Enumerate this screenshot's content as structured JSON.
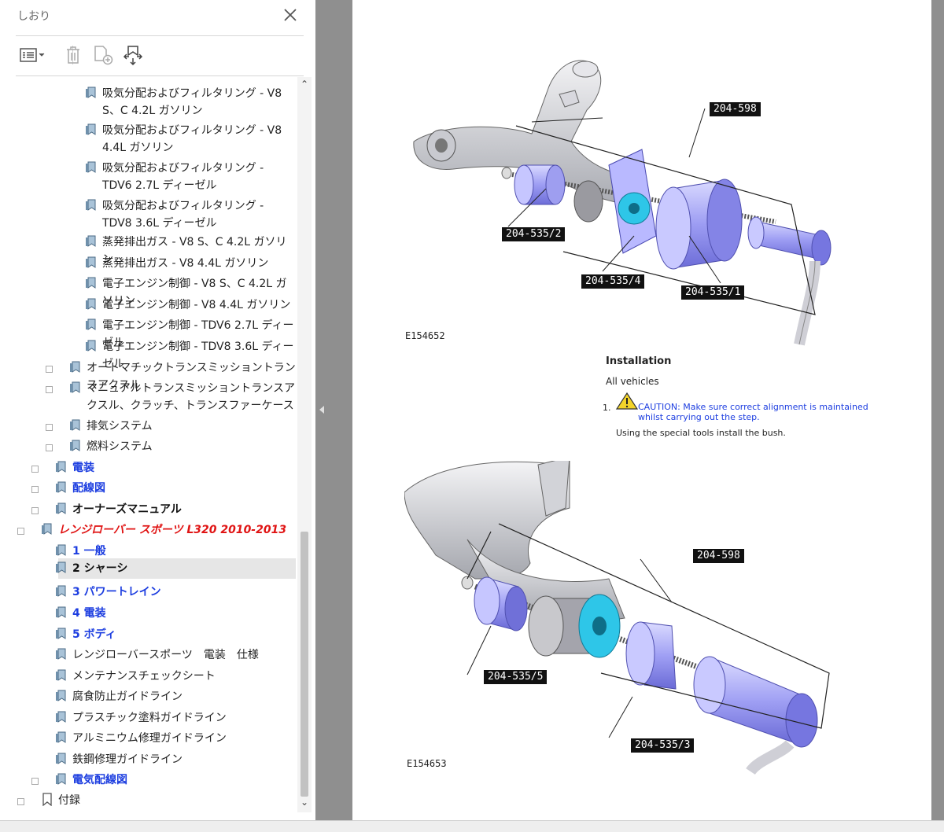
{
  "panel": {
    "title": "しおり",
    "toolbar": [
      "options-menu",
      "delete-bookmark",
      "new-bookmark",
      "expand-bookmark"
    ]
  },
  "tree": [
    {
      "label": "吸気分配およびフィルタリング - V8 S、C 4.2L ガソリン",
      "style": "norm",
      "expander": false
    },
    {
      "label": "吸気分配およびフィルタリング - V8 4.4L ガソリン",
      "style": "norm",
      "expander": false
    },
    {
      "label": "吸気分配およびフィルタリング - TDV6 2.7L ディーゼル",
      "style": "norm",
      "expander": false
    },
    {
      "label": "吸気分配およびフィルタリング - TDV8 3.6L ディーゼル",
      "style": "norm",
      "expander": false
    },
    {
      "label": "蒸発排出ガス - V8 S、C 4.2L ガソリン",
      "style": "norm",
      "expander": false
    },
    {
      "label": "蒸発排出ガス - V8 4.4L ガソリン",
      "style": "norm",
      "expander": false
    },
    {
      "label": "電子エンジン制御 - V8 S、C 4.2L ガソリン",
      "style": "norm",
      "expander": false
    },
    {
      "label": "電子エンジン制御 - V8 4.4L ガソリン",
      "style": "norm",
      "expander": false
    },
    {
      "label": "電子エンジン制御 - TDV6 2.7L ディーゼル",
      "style": "norm",
      "expander": false
    },
    {
      "label": "電子エンジン制御 - TDV8 3.6L ディーゼル",
      "style": "norm",
      "expander": false
    },
    {
      "label": "オートマチックトランスミッショントランスアクスル",
      "style": "norm",
      "expander": true
    },
    {
      "label": "マニュアルトランスミッショントランスアクスル、クラッチ、トランスファーケース",
      "style": "norm",
      "expander": true
    },
    {
      "label": "排気システム",
      "style": "norm",
      "expander": true
    },
    {
      "label": "燃料システム",
      "style": "norm",
      "expander": true
    },
    {
      "label": "電装",
      "style": "blue",
      "expander": true
    },
    {
      "label": "配線図",
      "style": "blue",
      "expander": true
    },
    {
      "label": "オーナーズマニュアル",
      "style": "black",
      "expander": true
    },
    {
      "label": "レンジローバー スポーツ L320 2010-2013",
      "style": "red",
      "expander": true
    },
    {
      "label": "1 一般",
      "style": "blue",
      "expander": false
    },
    {
      "label": "2 シャーシ",
      "style": "black",
      "expander": false,
      "selected": true
    },
    {
      "label": "3 パワートレイン",
      "style": "blue",
      "expander": false
    },
    {
      "label": "4 電装",
      "style": "blue",
      "expander": false
    },
    {
      "label": "5 ボディ",
      "style": "blue",
      "expander": false
    },
    {
      "label": "レンジローバースポーツ　電装　仕様",
      "style": "norm",
      "expander": false
    },
    {
      "label": "メンテナンスチェックシート",
      "style": "norm",
      "expander": false
    },
    {
      "label": "腐食防止ガイドライン",
      "style": "norm",
      "expander": false
    },
    {
      "label": "プラスチック塗料ガイドライン",
      "style": "norm",
      "expander": false
    },
    {
      "label": "アルミニウム修理ガイドライン",
      "style": "norm",
      "expander": false
    },
    {
      "label": "鉄鋼修理ガイドライン",
      "style": "norm",
      "expander": false
    },
    {
      "label": "電気配線図",
      "style": "blue",
      "expander": true
    },
    {
      "label": "付録",
      "style": "norm",
      "expander": true,
      "icon": "plain"
    }
  ],
  "doc": {
    "fig1": {
      "id": "E154652",
      "callouts": [
        "204-598",
        "204-535/2",
        "204-535/4",
        "204-535/1"
      ]
    },
    "section": "Installation",
    "subsection": "All vehicles",
    "step_number": "1.",
    "caution": "CAUTION: Make sure correct alignment is maintained whilst carrying out the step.",
    "step_text": "Using the special tools install the bush.",
    "fig2": {
      "id": "E154653",
      "callouts": [
        "204-598",
        "204-535/5",
        "204-535/3"
      ]
    }
  }
}
